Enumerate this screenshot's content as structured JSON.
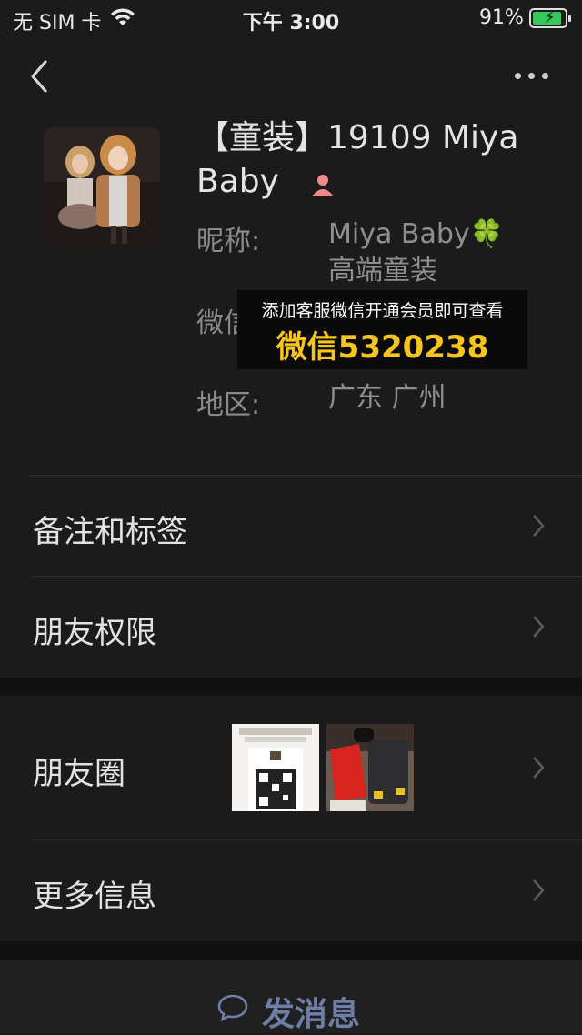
{
  "status_bar": {
    "carrier": "无 SIM 卡",
    "time": "下午 3:00",
    "battery_percent": "91%",
    "battery_level": 0.91,
    "icons": [
      "wifi-icon",
      "battery-charging-icon"
    ]
  },
  "nav": {
    "back_icon": "chevron-left-icon",
    "more_icon": "more-dots-icon"
  },
  "profile": {
    "name": "【童装】19109 Miya Baby",
    "gender_icon": "female-icon",
    "nickname_label": "昵称:",
    "nickname_value": "Miya Baby🍀 高端童装",
    "wechat_label": "微信",
    "region_label": "地区:",
    "region_value": "广东 广州"
  },
  "overlay_banner": {
    "line1": "添加客服微信开通会员即可查看",
    "line2": "微信5320238"
  },
  "menu": {
    "remark_tags": "备注和标签",
    "friend_permissions": "朋友权限",
    "moments": "朋友圈",
    "more_info": "更多信息"
  },
  "send_message": {
    "label": "发消息",
    "icon": "chat-bubble-icon"
  },
  "colors": {
    "background": "#1b1b1b",
    "banner_text": "#f7c51c",
    "send_text": "#6f7ea7",
    "battery_fill": "#35c759"
  }
}
